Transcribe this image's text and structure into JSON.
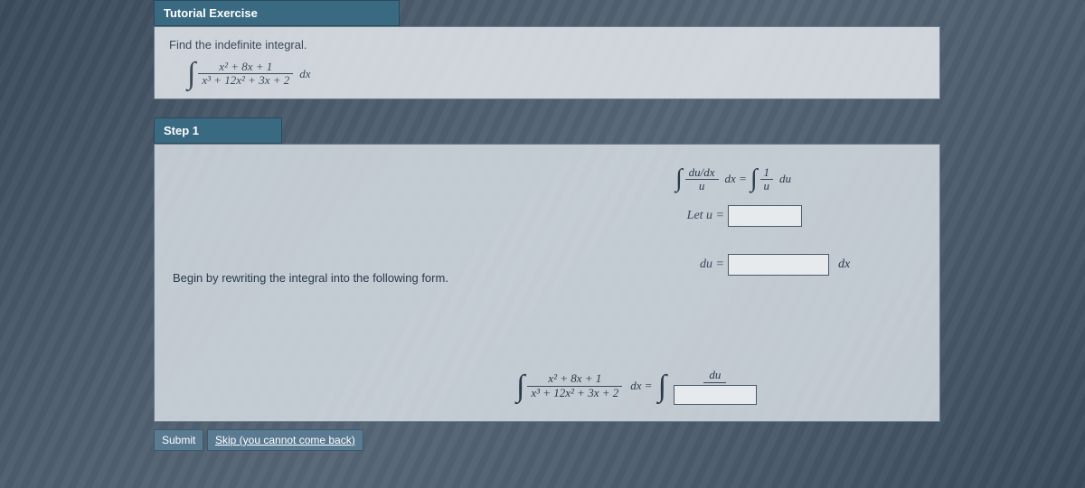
{
  "header": {
    "title": "Tutorial Exercise"
  },
  "exercise": {
    "prompt": "Find the indefinite integral.",
    "numerator": "x² + 8x + 1",
    "denominator": "x³ + 12x² + 3x + 2",
    "dx": "dx"
  },
  "step1": {
    "label": "Step 1",
    "rewrite_text": "Begin by rewriting the integral into the following form.",
    "eq_dudx_num": "du/dx",
    "eq_dudx_den": "u",
    "eq_dx": "dx =",
    "eq_rhs_num": "1",
    "eq_rhs_den": "u",
    "eq_rhs_du": "du",
    "let_label": "Let u =",
    "du_label": "du =",
    "du_after": "dx",
    "bottom_num": "x² + 8x + 1",
    "bottom_den": "x³ + 12x² + 3x + 2",
    "bottom_dx": "dx =",
    "du_top": "du"
  },
  "buttons": {
    "submit": "Submit",
    "skip": "Skip (you cannot come back)"
  }
}
